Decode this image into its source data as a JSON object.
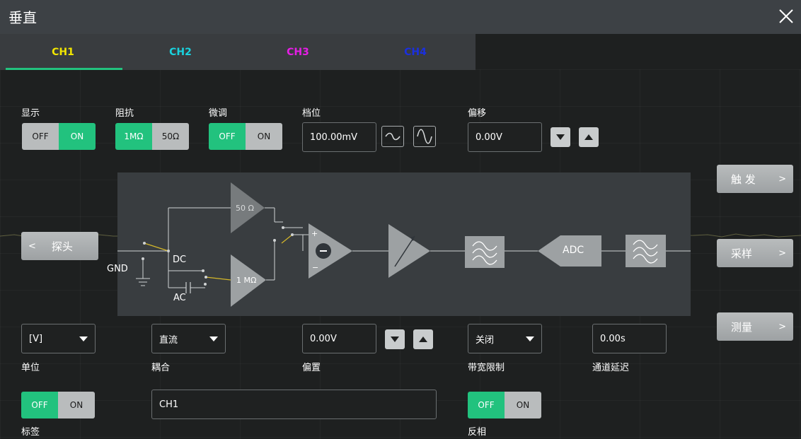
{
  "window": {
    "title": "垂直"
  },
  "tabs": [
    {
      "label": "CH1",
      "color": "#f2e600"
    },
    {
      "label": "CH2",
      "color": "#19d2de"
    },
    {
      "label": "CH3",
      "color": "#e61ee6"
    },
    {
      "label": "CH4",
      "color": "#1a2fe0"
    }
  ],
  "active_tab_index": 0,
  "display": {
    "label": "显示",
    "off": "OFF",
    "on": "ON",
    "value": "ON"
  },
  "impedance": {
    "label": "阻抗",
    "opt1": "1MΩ",
    "opt2": "50Ω",
    "value": "1MΩ"
  },
  "fine": {
    "label": "微调",
    "off": "OFF",
    "on": "ON",
    "value": "OFF"
  },
  "scale": {
    "label": "档位",
    "value": "100.00mV"
  },
  "offset": {
    "label": "偏移",
    "value": "0.00V"
  },
  "side_buttons": {
    "trigger": "触 发",
    "sample": "采样",
    "measure": "测量"
  },
  "probe_button": {
    "label": "探头"
  },
  "diagram": {
    "gnd": "GND",
    "dc": "DC",
    "ac": "AC",
    "r50": "50 Ω",
    "r1m": "1 MΩ",
    "adc": "ADC",
    "plus": "+",
    "minus": "−"
  },
  "unit": {
    "label": "单位",
    "value": "[V]"
  },
  "coupling": {
    "label": "耦合",
    "value": "直流"
  },
  "bias": {
    "label": "偏置",
    "value": "0.00V"
  },
  "bw_limit": {
    "label": "带宽限制",
    "value": "关闭"
  },
  "channel_delay": {
    "label": "通道延迟",
    "value": "0.00s"
  },
  "tag": {
    "label": "标签",
    "off": "OFF",
    "on": "ON",
    "value": "OFF",
    "text": "CH1"
  },
  "invert": {
    "label": "反相",
    "off": "OFF",
    "on": "ON",
    "value": "OFF"
  },
  "colors": {
    "accent": "#22c27e",
    "toggle_off": "#b9bcbd"
  }
}
